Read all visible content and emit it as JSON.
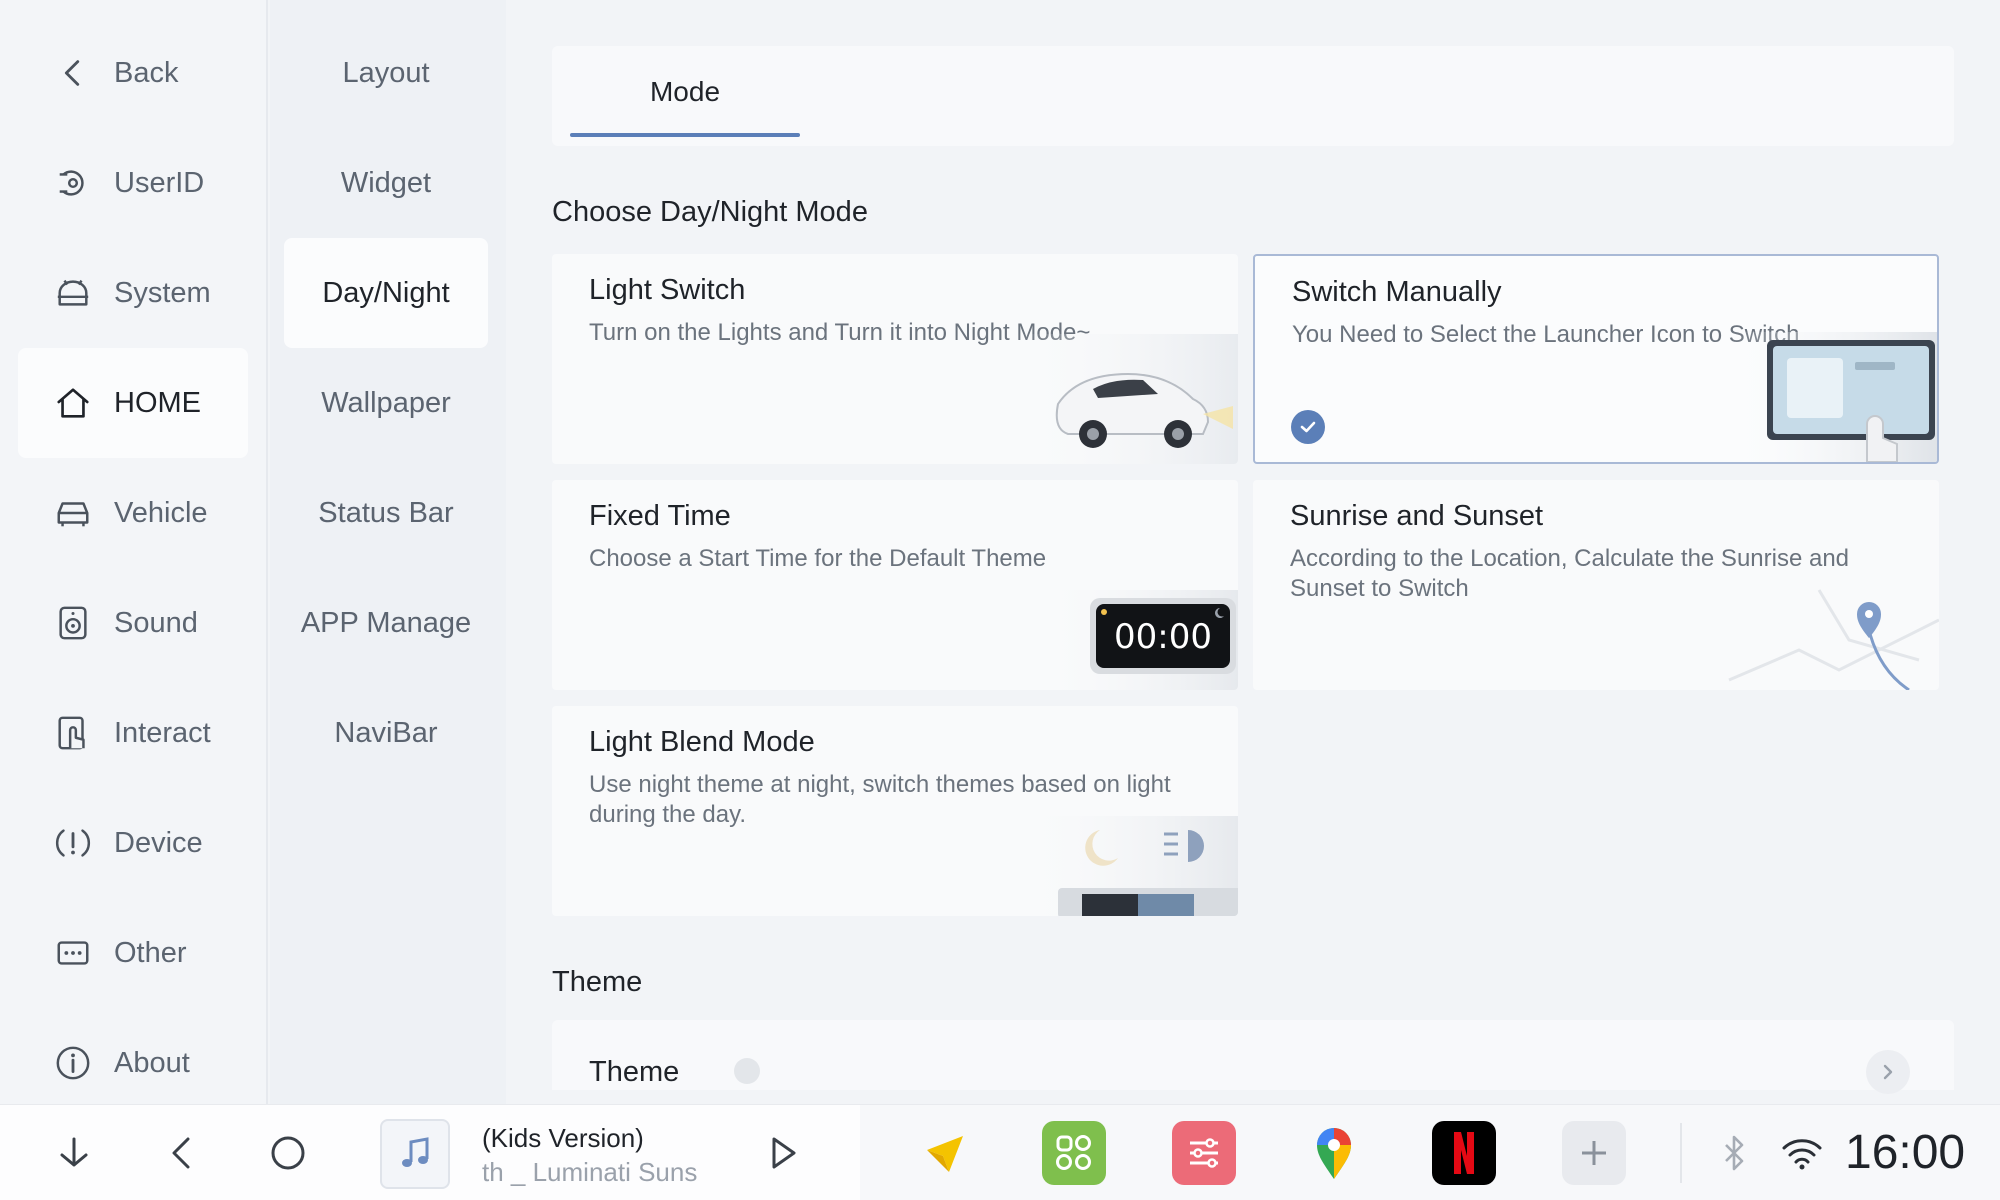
{
  "rail": {
    "items": [
      {
        "label": "Back",
        "icon": "chevron-left-icon"
      },
      {
        "label": "UserID",
        "icon": "user-id-icon"
      },
      {
        "label": "System",
        "icon": "android-icon"
      },
      {
        "label": "HOME",
        "icon": "home-icon",
        "active": true
      },
      {
        "label": "Vehicle",
        "icon": "car-icon"
      },
      {
        "label": "Sound",
        "icon": "speaker-icon"
      },
      {
        "label": "Interact",
        "icon": "touch-icon"
      },
      {
        "label": "Device",
        "icon": "alert-icon"
      },
      {
        "label": "Other",
        "icon": "more-icon"
      },
      {
        "label": "About",
        "icon": "info-icon"
      }
    ]
  },
  "subrail": {
    "items": [
      {
        "label": "Layout"
      },
      {
        "label": "Widget"
      },
      {
        "label": "Day/Night",
        "active": true
      },
      {
        "label": "Wallpaper"
      },
      {
        "label": "Status Bar"
      },
      {
        "label": "APP Manage"
      },
      {
        "label": "NaviBar"
      }
    ]
  },
  "main": {
    "tab": "Mode",
    "section_mode": "Choose Day/Night Mode",
    "cards": [
      {
        "title": "Light Switch",
        "desc": "Turn on the Lights and Turn it into Night Mode~",
        "art": "car-headlight-icon"
      },
      {
        "title": "Switch Manually",
        "desc": "You Need to Select the Launcher Icon to Switch",
        "art": "touchscreen-icon",
        "selected": true
      },
      {
        "title": "Fixed Time",
        "desc": "Choose a Start Time for the Default Theme",
        "art": "alarm-clock-icon",
        "clock_text": "00:00"
      },
      {
        "title": "Sunrise and Sunset",
        "desc": "According to the Location, Calculate the Sunrise and Sunset to Switch",
        "art": "map-pin-icon"
      },
      {
        "title": "Light Blend Mode",
        "desc": "Use night theme at night, switch themes based on light during the day.",
        "art": "moon-headlight-icon"
      }
    ],
    "section_theme": "Theme",
    "theme_row_label": "Theme"
  },
  "dock": {
    "media_line1": "(Kids Version)",
    "media_line2": "th _ Luminati Suns",
    "clock": "16:00",
    "accent": "#5b7fb8"
  }
}
